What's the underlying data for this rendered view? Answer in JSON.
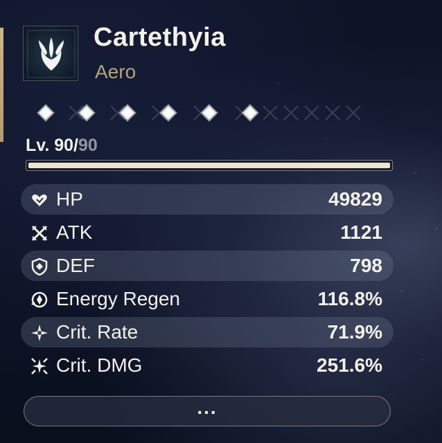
{
  "character": {
    "name": "Cartethyia",
    "element": "Aero",
    "emblem_icon": "aero-emblem-icon",
    "accent_color": "#b6a57c"
  },
  "sequence": {
    "unlocked_nodes": 6,
    "node_icon": "diamond-icon"
  },
  "level": {
    "current": "Lv. 90/",
    "max": "90",
    "progress": 1.0
  },
  "stats": [
    {
      "label": "HP",
      "value": "49829",
      "icon": "hp-icon"
    },
    {
      "label": "ATK",
      "value": "1121",
      "icon": "atk-icon"
    },
    {
      "label": "DEF",
      "value": "798",
      "icon": "def-icon"
    },
    {
      "label": "Energy Regen",
      "value": "116.8%",
      "icon": "energy-regen-icon"
    },
    {
      "label": "Crit. Rate",
      "value": "71.9%",
      "icon": "crit-rate-icon"
    },
    {
      "label": "Crit. DMG",
      "value": "251.6%",
      "icon": "crit-dmg-icon"
    }
  ],
  "more_button": {
    "label": "..."
  }
}
